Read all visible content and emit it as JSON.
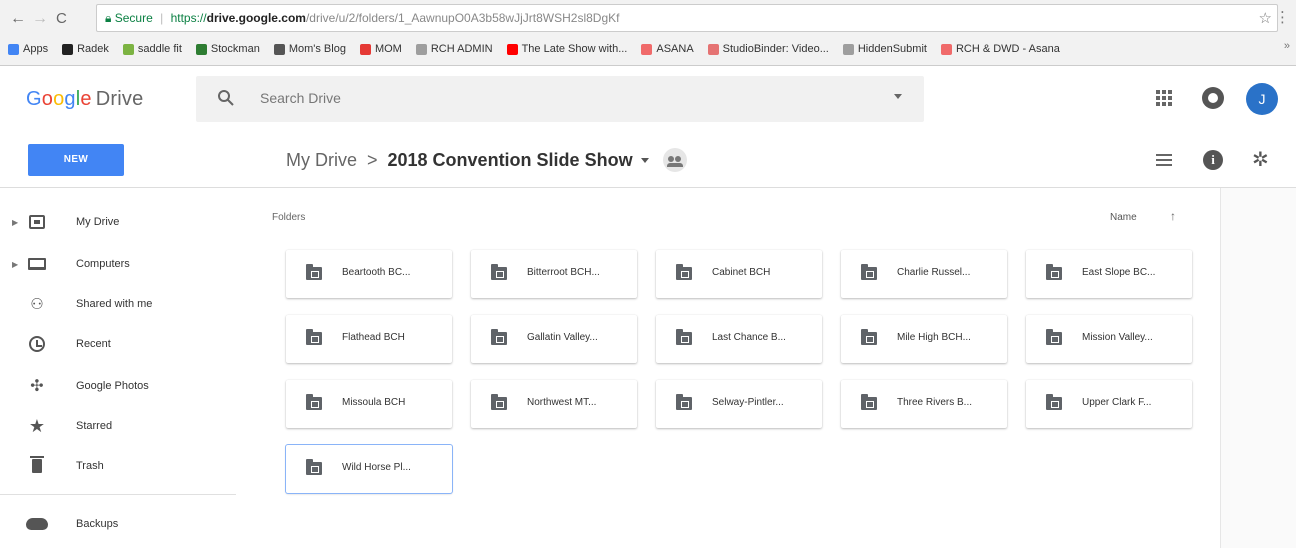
{
  "browser": {
    "secure_label": "Secure",
    "url_scheme": "https://",
    "url_host": "drive.google.com",
    "url_path": "/drive/u/2/folders/1_AawnupO0A3b58wJjJrt8WSH2sl8DgKf",
    "bookmarks": [
      {
        "label": "Apps",
        "icon": "apps-grid-icon",
        "color": "#4285f4"
      },
      {
        "label": "Radek",
        "icon": "bookmark-icon",
        "color": "#222222"
      },
      {
        "label": "saddle fit",
        "icon": "bookmark-icon",
        "color": "#7cb342"
      },
      {
        "label": "Stockman",
        "icon": "bookmark-icon",
        "color": "#2e7d32"
      },
      {
        "label": "Mom's Blog",
        "icon": "bookmark-icon",
        "color": "#555555"
      },
      {
        "label": "MOM",
        "icon": "bookmark-icon",
        "color": "#e53935"
      },
      {
        "label": "RCH ADMIN",
        "icon": "page-icon",
        "color": "#9e9e9e"
      },
      {
        "label": "The Late Show with...",
        "icon": "youtube-icon",
        "color": "#ff0000"
      },
      {
        "label": "ASANA",
        "icon": "asana-icon",
        "color": "#f06a6a"
      },
      {
        "label": "StudioBinder: Video...",
        "icon": "bookmark-icon",
        "color": "#e57373"
      },
      {
        "label": "HiddenSubmit",
        "icon": "page-icon",
        "color": "#9e9e9e"
      },
      {
        "label": "RCH & DWD - Asana",
        "icon": "asana-icon",
        "color": "#f06a6a"
      }
    ],
    "more_label": "»"
  },
  "drive": {
    "search_placeholder": "Search Drive",
    "avatar_letter": "J",
    "new_label": "NEW",
    "breadcrumb_root": "My Drive",
    "breadcrumb_sep": ">",
    "breadcrumb_current": "2018 Convention Slide Show",
    "accent": "#4285f4"
  },
  "sidebar": {
    "items": [
      {
        "label": "My Drive",
        "icon": "drive-icon",
        "expandable": true
      },
      {
        "label": "Computers",
        "icon": "computer-icon",
        "expandable": true
      },
      {
        "label": "Shared with me",
        "icon": "people-icon",
        "expandable": false
      },
      {
        "label": "Recent",
        "icon": "clock-icon",
        "expandable": false
      },
      {
        "label": "Google Photos",
        "icon": "photos-icon",
        "expandable": false
      },
      {
        "label": "Starred",
        "icon": "star-icon",
        "expandable": false
      },
      {
        "label": "Trash",
        "icon": "trash-icon",
        "expandable": false
      },
      {
        "label": "Backups",
        "icon": "cloud-icon",
        "expandable": false
      }
    ]
  },
  "main": {
    "section_label": "Folders",
    "sort_label": "Name",
    "sort_direction": "ascending",
    "folders": [
      {
        "name": "Beartooth BC...",
        "selected": false
      },
      {
        "name": "Bitterroot BCH...",
        "selected": false
      },
      {
        "name": "Cabinet BCH",
        "selected": false
      },
      {
        "name": "Charlie Russel...",
        "selected": false
      },
      {
        "name": "East Slope BC...",
        "selected": false
      },
      {
        "name": "Flathead BCH",
        "selected": false
      },
      {
        "name": "Gallatin Valley...",
        "selected": false
      },
      {
        "name": "Last Chance B...",
        "selected": false
      },
      {
        "name": "Mile High BCH...",
        "selected": false
      },
      {
        "name": "Mission Valley...",
        "selected": false
      },
      {
        "name": "Missoula BCH",
        "selected": false
      },
      {
        "name": "Northwest MT...",
        "selected": false
      },
      {
        "name": "Selway-Pintler...",
        "selected": false
      },
      {
        "name": "Three Rivers B...",
        "selected": false
      },
      {
        "name": "Upper Clark F...",
        "selected": false
      },
      {
        "name": "Wild Horse Pl...",
        "selected": true
      }
    ]
  }
}
